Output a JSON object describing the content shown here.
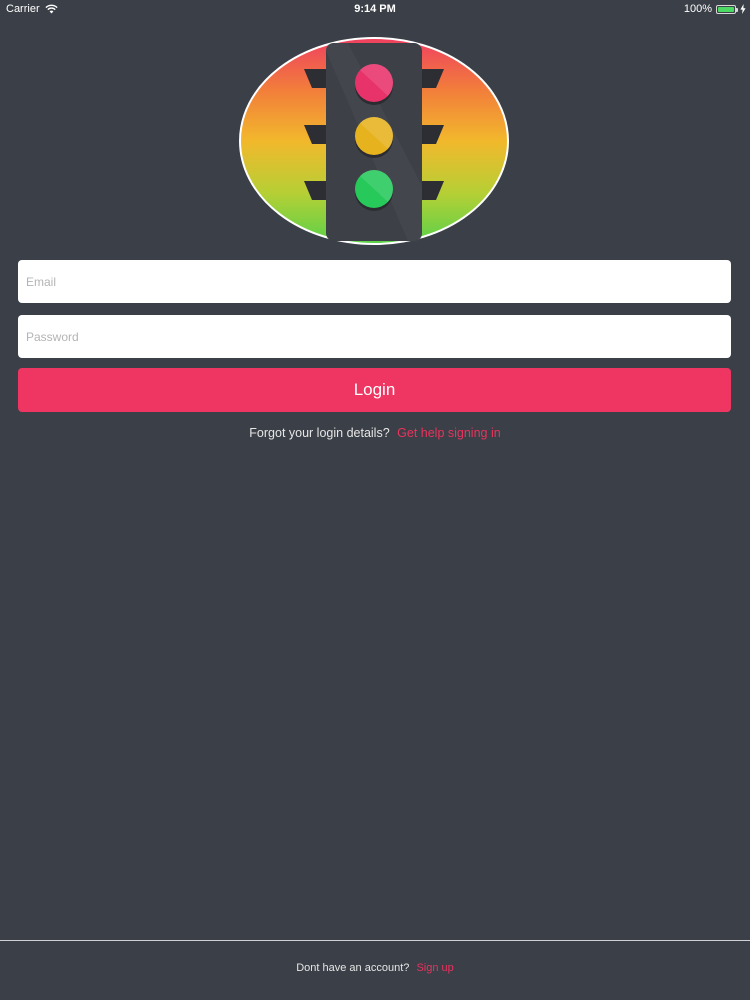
{
  "status_bar": {
    "carrier": "Carrier",
    "time": "9:14 PM",
    "battery": "100%",
    "battery_level": 1.0
  },
  "logo": {
    "icon": "traffic-light-icon"
  },
  "login_form": {
    "email_placeholder": "Email",
    "password_placeholder": "Password",
    "login_label": "Login"
  },
  "forgot": {
    "text": "Forgot your login details?",
    "link": "Get help signing in"
  },
  "footer": {
    "text": "Dont have an account?",
    "link": "Sign up"
  },
  "colors": {
    "background": "#3b3f47",
    "accent": "#ef3562",
    "light_red": "#e8336a",
    "light_yellow": "#e6b21e",
    "light_green": "#26c95a"
  }
}
